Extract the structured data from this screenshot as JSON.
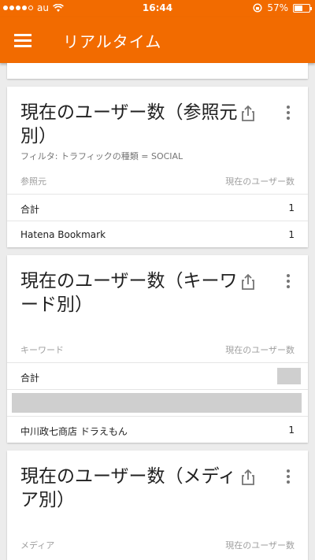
{
  "status_bar": {
    "carrier": "au",
    "time": "16:44",
    "battery": "57%",
    "battery_level": 0.57
  },
  "app_bar": {
    "title": "リアルタイム"
  },
  "cards": [
    {
      "title": "現在のユーザー数（参照元別）",
      "filter": "フィルタ: トラフィックの種類 = SOCIAL",
      "col_left": "参照元",
      "col_right": "現在のユーザー数",
      "rows": [
        {
          "label": "合計",
          "value": "1"
        },
        {
          "label": "Hatena Bookmark",
          "value": "1"
        }
      ]
    },
    {
      "title": "現在のユーザー数（キーワード別）",
      "col_left": "キーワード",
      "col_right": "現在のユーザー数",
      "rows": [
        {
          "label": "合計",
          "value": ""
        },
        {
          "label": "",
          "value": ""
        },
        {
          "label": "中川政七商店 ドラえもん",
          "value": "1"
        }
      ]
    },
    {
      "title": "現在のユーザー数（メディア別）",
      "col_left": "メディア",
      "col_right": "現在のユーザー数"
    }
  ]
}
